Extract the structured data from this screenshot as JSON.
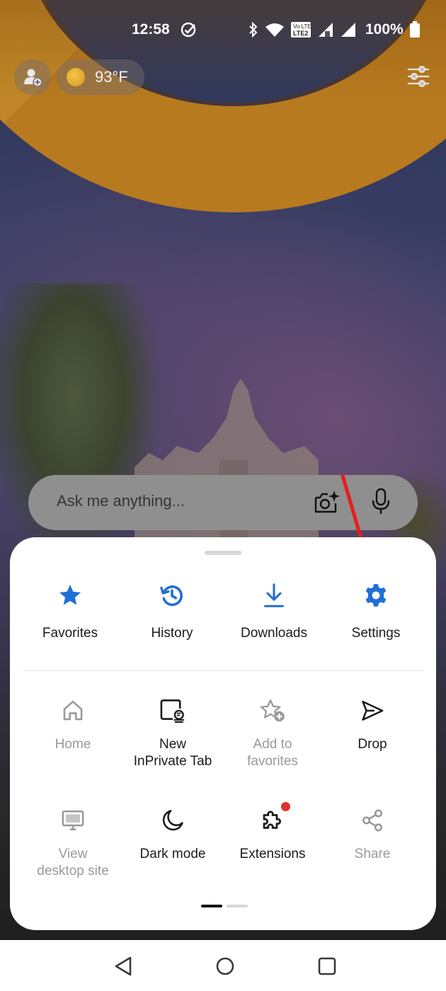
{
  "status_bar": {
    "time": "12:58",
    "battery": "100%",
    "icons": [
      "check-circle-icon",
      "bluetooth-icon",
      "wifi-icon",
      "volte-lte2-icon",
      "signal-icon",
      "signal-icon",
      "battery-icon"
    ]
  },
  "top_bar": {
    "profile_icon": "add-profile-icon",
    "weather": {
      "icon": "sun-icon",
      "temperature": "93°F"
    },
    "customize_icon": "sliders-icon"
  },
  "search": {
    "placeholder": "Ask me anything...",
    "icons": [
      "visual-search-icon",
      "microphone-icon"
    ]
  },
  "menu": {
    "top_row": [
      {
        "label": "Favorites",
        "icon": "star-icon"
      },
      {
        "label": "History",
        "icon": "history-icon"
      },
      {
        "label": "Downloads",
        "icon": "download-icon"
      },
      {
        "label": "Settings",
        "icon": "gear-icon"
      }
    ],
    "grid_row1": [
      {
        "label": "Home",
        "icon": "home-icon",
        "disabled": true
      },
      {
        "label": "New\nInPrivate Tab",
        "icon": "inprivate-tab-icon",
        "disabled": false
      },
      {
        "label": "Add to\nfavorites",
        "icon": "star-add-icon",
        "disabled": true
      },
      {
        "label": "Drop",
        "icon": "send-icon",
        "disabled": false
      }
    ],
    "grid_row2": [
      {
        "label": "View\ndesktop site",
        "icon": "desktop-icon",
        "disabled": true
      },
      {
        "label": "Dark mode",
        "icon": "moon-icon",
        "disabled": false
      },
      {
        "label": "Extensions",
        "icon": "puzzle-icon",
        "disabled": false
      },
      {
        "label": "Share",
        "icon": "share-icon",
        "disabled": true
      }
    ],
    "pages": 2,
    "current_page": 1
  },
  "colors": {
    "accent": "#1f6fd6",
    "disabled": "#9a9a9a",
    "annotation_arrow": "#e41e1e",
    "notification_dot": "#e0312f"
  },
  "nav_bar": [
    "back-icon",
    "home-circle-icon",
    "recents-icon"
  ]
}
